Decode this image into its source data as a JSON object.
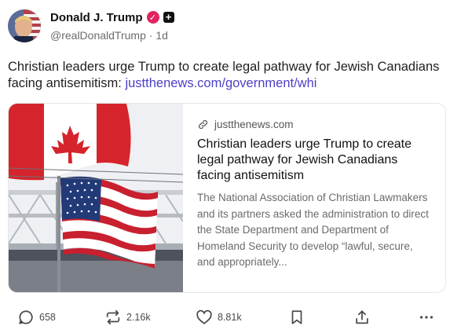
{
  "post": {
    "author": {
      "name": "Donald J. Trump",
      "handle": "@realDonaldTrump",
      "separator": "·",
      "time": "1d",
      "verified_glyph": "✓",
      "plus_glyph": "+"
    },
    "text_prefix": "Christian leaders urge Trump to create legal pathway for Jewish Canadians facing antisemitism: ",
    "link_text": "justthenews.com/government/whi",
    "card": {
      "domain": "justthenews.com",
      "title": "Christian leaders urge Trump to create legal pathway for Jewish Canadians facing antisemitism",
      "description": "The National Association of Christian Lawmakers and its partners asked the administration to direct the State Department and Department of Homeland Security to develop “lawful, secure, and appropriately..."
    },
    "actions": {
      "replies": "658",
      "reposts": "2.16k",
      "likes": "8.81k"
    }
  },
  "icons": [
    "verified-badge-icon",
    "plus-icon",
    "link-icon",
    "reply-icon",
    "repost-icon",
    "like-icon",
    "bookmark-icon",
    "share-icon",
    "more-icon"
  ],
  "colors": {
    "link": "#4a3fc7",
    "verified": "#e0245e",
    "muted": "#6b6b6b"
  }
}
